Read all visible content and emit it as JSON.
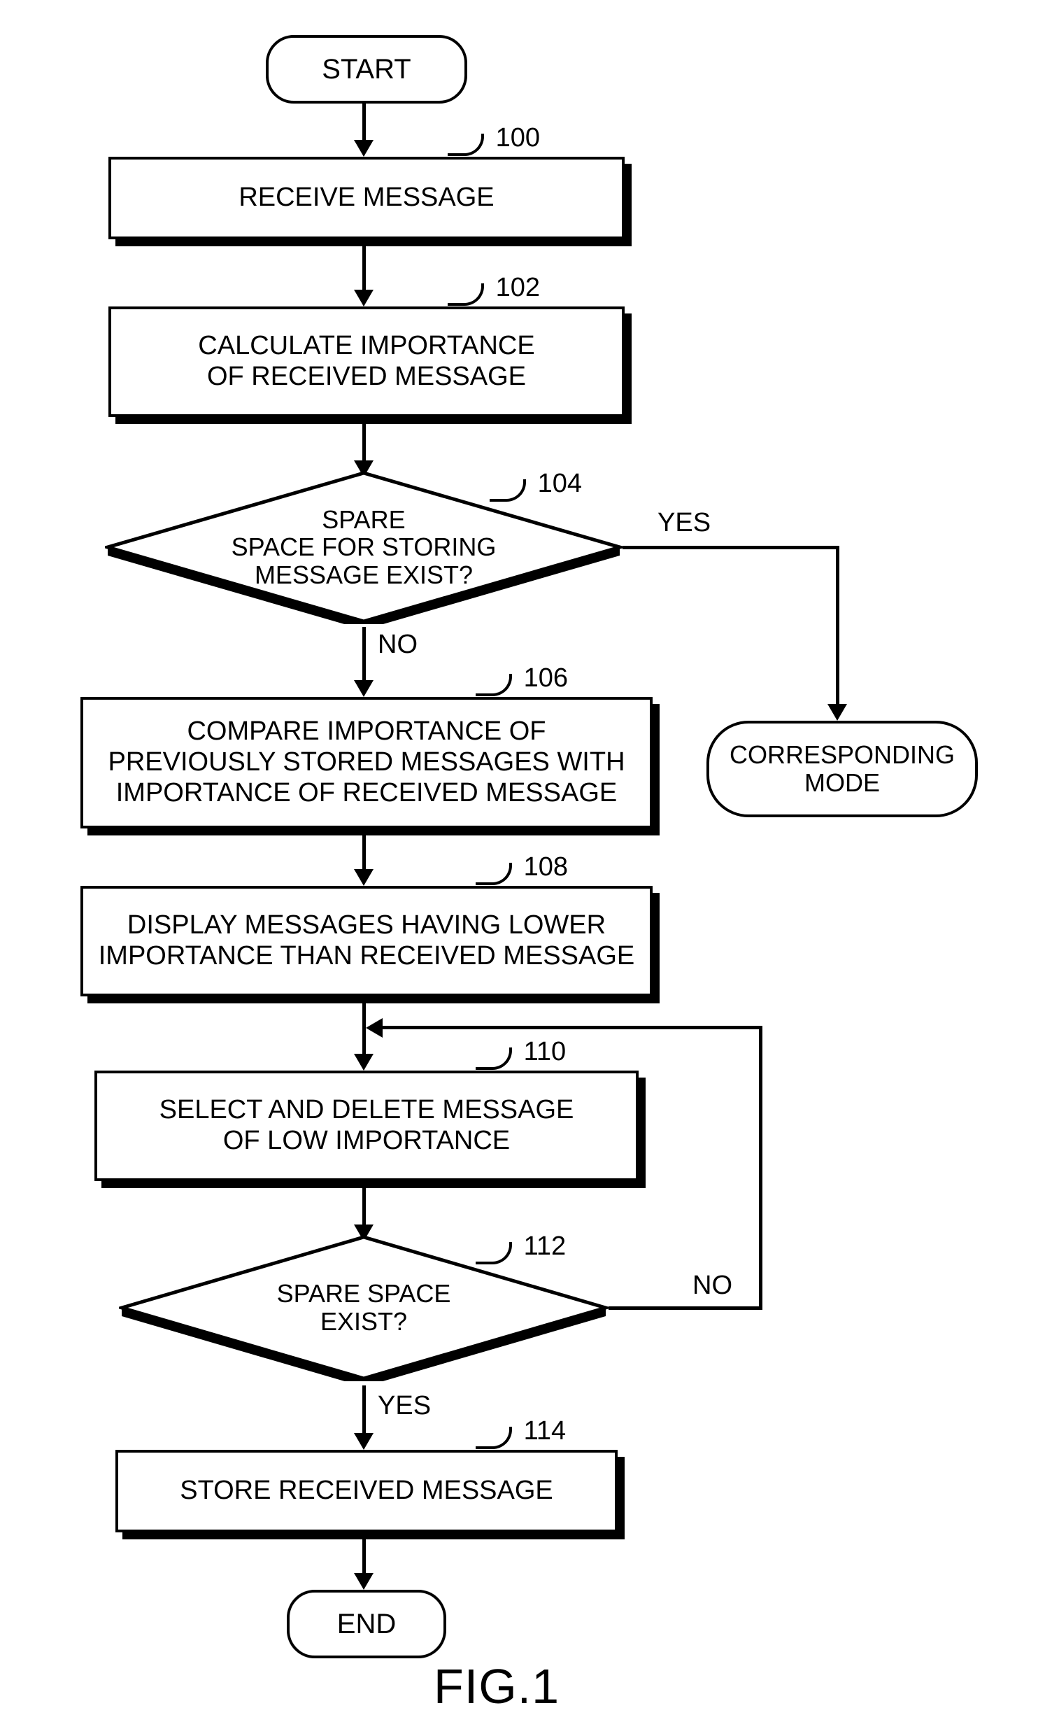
{
  "figure_label": "FIG.1",
  "nodes": {
    "start": {
      "text": "START"
    },
    "s100": {
      "text": "RECEIVE MESSAGE",
      "ref": "100"
    },
    "s102": {
      "text": "CALCULATE IMPORTANCE\nOF RECEIVED MESSAGE",
      "ref": "102"
    },
    "d104": {
      "text": "SPARE\nSPACE FOR STORING\nMESSAGE EXIST?",
      "ref": "104",
      "yes": "YES",
      "no": "NO"
    },
    "s106": {
      "text": "COMPARE IMPORTANCE OF\nPREVIOUSLY STORED MESSAGES WITH\nIMPORTANCE OF RECEIVED MESSAGE",
      "ref": "106"
    },
    "s108": {
      "text": "DISPLAY MESSAGES HAVING LOWER\nIMPORTANCE THAN RECEIVED MESSAGE",
      "ref": "108"
    },
    "s110": {
      "text": "SELECT AND DELETE MESSAGE\nOF LOW IMPORTANCE",
      "ref": "110"
    },
    "d112": {
      "text": "SPARE SPACE\nEXIST?",
      "ref": "112",
      "yes": "YES",
      "no": "NO"
    },
    "s114": {
      "text": "STORE RECEIVED MESSAGE",
      "ref": "114"
    },
    "corr": {
      "text": "CORRESPONDING\nMODE"
    },
    "end": {
      "text": "END"
    }
  }
}
